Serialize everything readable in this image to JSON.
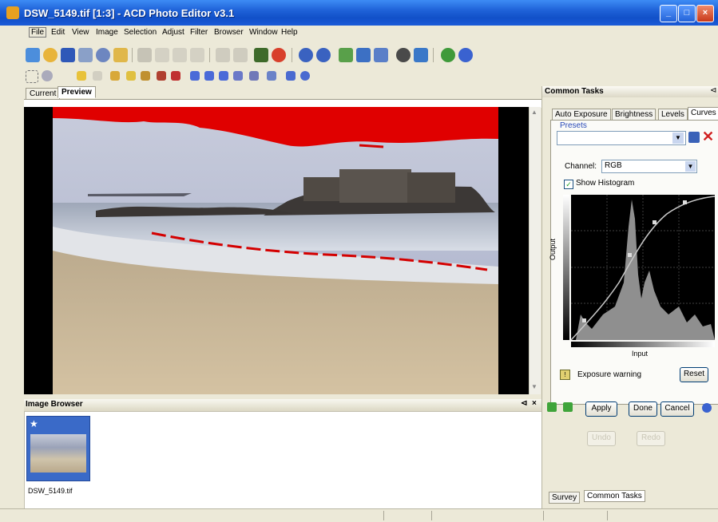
{
  "window": {
    "title": "DSW_5149.tif [1:3] - ACD Photo Editor v3.1",
    "controls": [
      "_",
      "□",
      "×"
    ]
  },
  "menu": [
    "File",
    "Edit",
    "View",
    "Image",
    "Selection",
    "Adjust",
    "Filter",
    "Browser",
    "Window",
    "Help"
  ],
  "view_tabs": [
    "Current",
    "Preview"
  ],
  "image_browser": {
    "title": "Image Browser",
    "thumbnail_label": "DSW_5149.tif"
  },
  "panel": {
    "title": "Common Tasks",
    "tabs": [
      "Auto Exposure",
      "Brightness",
      "Levels",
      "Curves"
    ],
    "presets_label": "Presets",
    "channel_label": "Channel:",
    "channel_value": "RGB",
    "show_histogram_label": "Show Histogram",
    "output_axis_label": "Output",
    "input_axis_label": "Input",
    "exposure_warning_label": "Exposure warning",
    "reset_label": "Reset",
    "apply_label": "Apply",
    "done_label": "Done",
    "cancel_label": "Cancel",
    "undo_label": "Undo",
    "redo_label": "Redo",
    "bottom_tabs": [
      "Survey",
      "Common Tasks"
    ]
  },
  "colors": {
    "titlebar": "#1f62d8",
    "clipping_warning": "#e00000"
  }
}
